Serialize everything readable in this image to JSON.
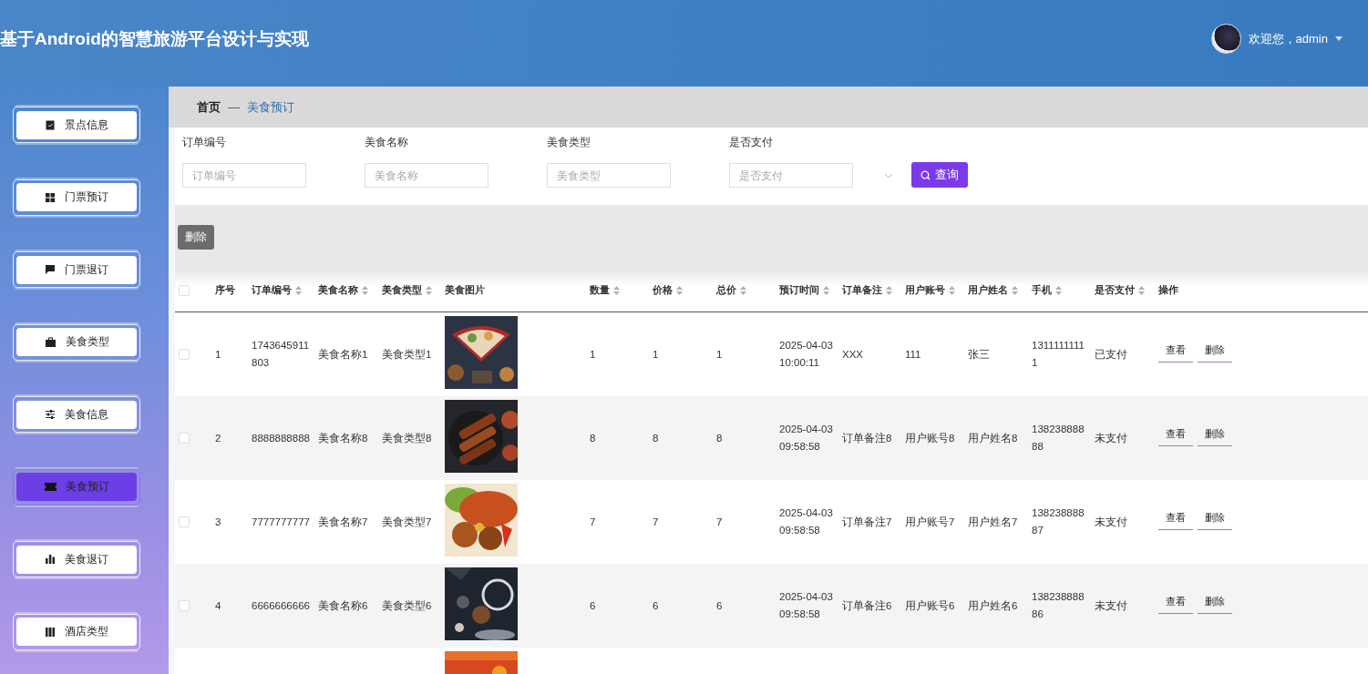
{
  "header": {
    "title": "基于Android的智慧旅游平台设计与实现",
    "greeting": "欢迎您，admin"
  },
  "sidebar": {
    "items": [
      {
        "label": "景点信息",
        "selected": false
      },
      {
        "label": "门票预订",
        "selected": false
      },
      {
        "label": "门票退订",
        "selected": false
      },
      {
        "label": "美食类型",
        "selected": false
      },
      {
        "label": "美食信息",
        "selected": false
      },
      {
        "label": "美食预订",
        "selected": true
      },
      {
        "label": "美食退订",
        "selected": false
      },
      {
        "label": "酒店类型",
        "selected": false
      }
    ]
  },
  "breadcrumb": {
    "home": "首页",
    "separator": "—",
    "current": "美食预订"
  },
  "search": {
    "fields": [
      {
        "label": "订单编号",
        "placeholder": "订单编号",
        "kind": "text"
      },
      {
        "label": "美食名称",
        "placeholder": "美食名称",
        "kind": "text"
      },
      {
        "label": "美食类型",
        "placeholder": "美食类型",
        "kind": "text"
      },
      {
        "label": "是否支付",
        "placeholder": "是否支付",
        "kind": "select"
      }
    ],
    "button": "查询"
  },
  "actions": {
    "delete": "删除"
  },
  "table": {
    "header_checked": false,
    "columns": [
      {
        "label": "序号",
        "sortable": false
      },
      {
        "label": "订单编号",
        "sortable": true
      },
      {
        "label": "美食名称",
        "sortable": true
      },
      {
        "label": "美食类型",
        "sortable": true
      },
      {
        "label": "美食图片",
        "sortable": false
      },
      {
        "label": "数量",
        "sortable": true
      },
      {
        "label": "价格",
        "sortable": true
      },
      {
        "label": "总价",
        "sortable": true
      },
      {
        "label": "预订时间",
        "sortable": true
      },
      {
        "label": "订单备注",
        "sortable": true
      },
      {
        "label": "用户账号",
        "sortable": true
      },
      {
        "label": "用户姓名",
        "sortable": true
      },
      {
        "label": "手机",
        "sortable": true
      },
      {
        "label": "是否支付",
        "sortable": true
      },
      {
        "label": "操作",
        "sortable": false
      }
    ],
    "rows": [
      {
        "checked": false,
        "index": "1",
        "order_no": "1743645911803",
        "name": "美食名称1",
        "type": "美食类型1",
        "image": {
          "kind": "picture"
        },
        "quantity": "1",
        "price": "1",
        "total": "1",
        "time": "2025-04-03 10:00:11",
        "note": "XXX",
        "account": "111",
        "user_name": "张三",
        "phone": "13111111111",
        "paid": "已支付",
        "view": "查看",
        "delete": "删除"
      },
      {
        "checked": false,
        "index": "2",
        "order_no": "8888888888",
        "name": "美食名称8",
        "type": "美食类型8",
        "image": {
          "kind": "picture"
        },
        "quantity": "8",
        "price": "8",
        "total": "8",
        "time": "2025-04-03 09:58:58",
        "note": "订单备注8",
        "account": "用户账号8",
        "user_name": "用户姓名8",
        "phone": "13823888888",
        "paid": "未支付",
        "view": "查看",
        "delete": "删除"
      },
      {
        "checked": false,
        "index": "3",
        "order_no": "7777777777",
        "name": "美食名称7",
        "type": "美食类型7",
        "image": {
          "kind": "picture"
        },
        "quantity": "7",
        "price": "7",
        "total": "7",
        "time": "2025-04-03 09:58:58",
        "note": "订单备注7",
        "account": "用户账号7",
        "user_name": "用户姓名7",
        "phone": "13823888887",
        "paid": "未支付",
        "view": "查看",
        "delete": "删除"
      },
      {
        "checked": false,
        "index": "4",
        "order_no": "6666666666",
        "name": "美食名称6",
        "type": "美食类型6",
        "image": {
          "kind": "picture"
        },
        "quantity": "6",
        "price": "6",
        "total": "6",
        "time": "2025-04-03 09:58:58",
        "note": "订单备注6",
        "account": "用户账号6",
        "user_name": "用户姓名6",
        "phone": "13823888886",
        "paid": "未支付",
        "view": "查看",
        "delete": "删除"
      },
      {
        "image": {
          "kind": "picture"
        }
      }
    ]
  }
}
